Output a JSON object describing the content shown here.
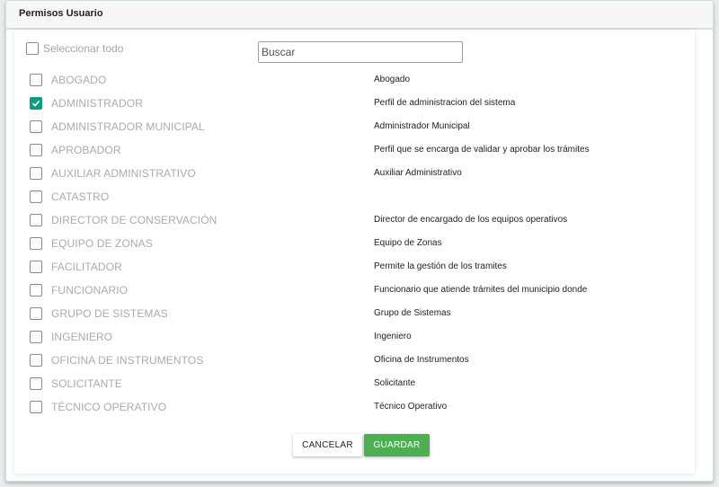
{
  "dialog": {
    "title": "Permisos Usuario",
    "select_all_label": "Seleccionar todo",
    "search_placeholder": "Buscar",
    "cancel_label": "CANCELAR",
    "save_label": "GUARDAR",
    "accent_color": "#0f9d7e",
    "save_color": "#4caf50"
  },
  "roles": [
    {
      "name": "ABOGADO",
      "description": "Abogado",
      "checked": false
    },
    {
      "name": "ADMINISTRADOR",
      "description": "Perfil de administracion del sistema",
      "checked": true
    },
    {
      "name": "ADMINISTRADOR MUNICIPAL",
      "description": "Administrador Municipal",
      "checked": false
    },
    {
      "name": "APROBADOR",
      "description": "Perfil que se encarga de validar y aprobar los trámites",
      "checked": false
    },
    {
      "name": "AUXILIAR ADMINISTRATIVO",
      "description": "Auxiliar Administrativo",
      "checked": false
    },
    {
      "name": "CATASTRO",
      "description": "",
      "checked": false
    },
    {
      "name": "DIRECTOR DE CONSERVACIÓN",
      "description": "Director de encargado de los equipos operativos",
      "checked": false
    },
    {
      "name": "EQUIPO DE ZONAS",
      "description": "Equipo de Zonas",
      "checked": false
    },
    {
      "name": "FACILITADOR",
      "description": "Permite la gestión de los tramites",
      "checked": false
    },
    {
      "name": "FUNCIONARIO",
      "description": "Funcionario que atiende trámites del municipio donde",
      "checked": false
    },
    {
      "name": "GRUPO DE SISTEMAS",
      "description": "Grupo de Sistemas",
      "checked": false
    },
    {
      "name": "INGENIERO",
      "description": "Ingeniero",
      "checked": false
    },
    {
      "name": "OFICINA DE INSTRUMENTOS",
      "description": "Oficina de Instrumentos",
      "checked": false
    },
    {
      "name": "SOLICITANTE",
      "description": "Solicitante",
      "checked": false
    },
    {
      "name": "TÉCNICO OPERATIVO",
      "description": "Técnico Operativo",
      "checked": false
    }
  ]
}
